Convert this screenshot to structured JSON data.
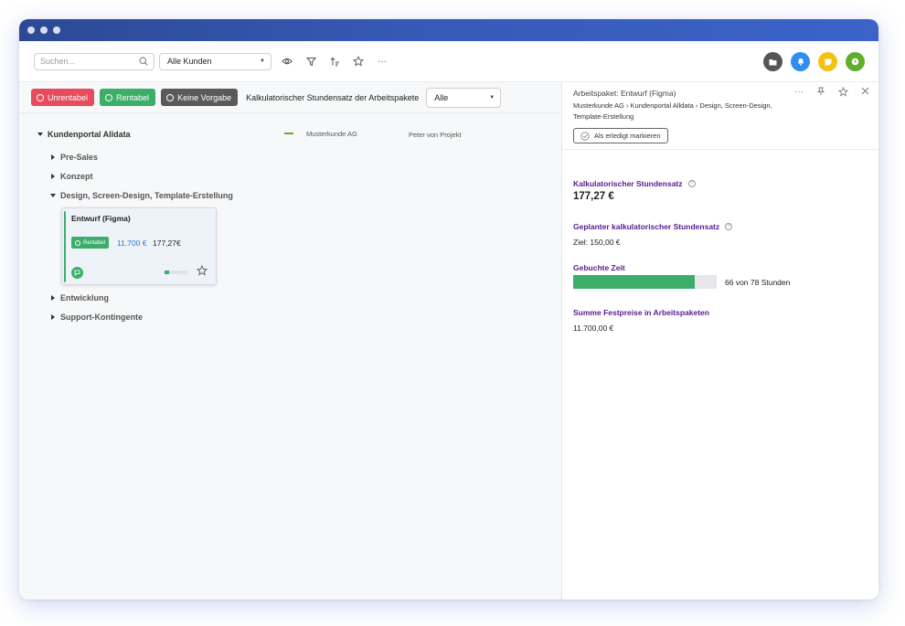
{
  "toolbar": {
    "search_placeholder": "Suchen...",
    "customer_filter": "Alle Kunden",
    "header_icons": [
      {
        "name": "folder-icon",
        "color": "#555555"
      },
      {
        "name": "bell-icon",
        "color": "#2f8ff0"
      },
      {
        "name": "note-icon",
        "color": "#f5c214"
      },
      {
        "name": "clock-icon",
        "color": "#5faf2a"
      }
    ]
  },
  "filters": {
    "unprofitable": {
      "label": "Unrentabel",
      "color": "#e74c5c"
    },
    "profitable": {
      "label": "Rentabel",
      "color": "#3dae6a"
    },
    "none": {
      "label": "Keine Vorgabe",
      "color": "#5a5a5a"
    },
    "rate_label": "Kalkulatorischer Stundensatz der Arbeitspakete",
    "rate_select": "Alle"
  },
  "tree": {
    "project": {
      "name": "Kundenportal Alldata",
      "customer": "Musterkunde AG",
      "manager": "Peter von Projekt"
    },
    "groups": {
      "presales": "Pre-Sales",
      "concept": "Konzept",
      "design": "Design, Screen-Design, Template-Erstellung",
      "development": "Entwicklung",
      "support": "Support-Kontingente"
    },
    "card": {
      "title": "Entwurf (Figma)",
      "badge": "Rentabel",
      "price": "11.700 €",
      "rate": "177,27€",
      "progress": 0.2
    }
  },
  "panel": {
    "title": "Arbeitspaket: Entwurf (Figma)",
    "breadcrumb": "Musterkunde AG › Kundenportal Alldata › Design, Screen-Design, Template-Erstellung",
    "mark_done": "Als erledigt markieren",
    "rate_label": "Kalkulatorischer Stundensatz",
    "rate_value": "177,27 €",
    "planned_label": "Geplanter kalkulatorischer Stundensatz",
    "planned_value": "Ziel: 150,00 €",
    "booked_label": "Gebuchte Zeit",
    "booked_hours": 66,
    "total_hours": 78,
    "booked_text": "66 von 78 Stunden",
    "fixed_label": "Summe Festpreise in Arbeitspaketen",
    "fixed_value": "11.700,00 €"
  }
}
